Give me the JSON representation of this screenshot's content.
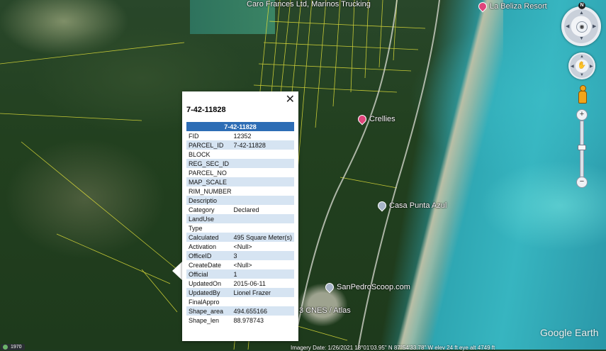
{
  "map": {
    "places": {
      "top_label": "Caro Frances Ltd, Marinos Trucking",
      "belize_resort": "La Beliza Resort",
      "crellies": "Crellies",
      "casa_punta_azul": "Casa Punta Azul",
      "sanpedroscoop": "SanPedroScoop.com",
      "cnes": "3 CNES / Atlas"
    },
    "pin_colors": {
      "pink": "#e0457b",
      "grey": "#a7b4c8"
    },
    "parcel_line_color": "#e3e13a"
  },
  "popup": {
    "close_label": "✕",
    "title": "7-42-11828",
    "table_header": "7-42-11828",
    "header_color": "#2d6db5",
    "rows": [
      {
        "key": "FID",
        "value": "12352"
      },
      {
        "key": "PARCEL_ID",
        "value": "7-42-11828"
      },
      {
        "key": "BLOCK",
        "value": ""
      },
      {
        "key": "REG_SEC_ID",
        "value": ""
      },
      {
        "key": "PARCEL_NO",
        "value": ""
      },
      {
        "key": "MAP_SCALE",
        "value": ""
      },
      {
        "key": "RIM_NUMBER",
        "value": ""
      },
      {
        "key": "Descriptio",
        "value": ""
      },
      {
        "key": "Category",
        "value": "Declared"
      },
      {
        "key": "LandUse",
        "value": ""
      },
      {
        "key": "Type",
        "value": ""
      },
      {
        "key": "Calculated",
        "value": "495 Square Meter(s)"
      },
      {
        "key": "Activation",
        "value": "<Null>"
      },
      {
        "key": "OfficeID",
        "value": "3"
      },
      {
        "key": "CreateDate",
        "value": "<Null>"
      },
      {
        "key": "Official",
        "value": "1"
      },
      {
        "key": "UpdatedOn",
        "value": "2015-06-11"
      },
      {
        "key": "UpdatedBy",
        "value": "Lionel Frazer"
      },
      {
        "key": "FinalAppro",
        "value": ""
      },
      {
        "key": "Shape_area",
        "value": "494.655166"
      },
      {
        "key": "Shape_len",
        "value": "88.978743"
      }
    ]
  },
  "controls": {
    "compass_north": "N",
    "look_center_icon": "eye-icon",
    "move_center_icon": "hand-icon",
    "zoom_in": "+",
    "zoom_out": "−",
    "zoom_mid": "−",
    "pegman_color": "#f2a51a"
  },
  "branding": {
    "logo": "Google Earth"
  },
  "status": {
    "year": "1970",
    "text": "Imagery Date: 1/26/2021    18°01'03.95\" N    87°54'33.78\" W  elev   24 ft    eye alt  4749 ft"
  }
}
